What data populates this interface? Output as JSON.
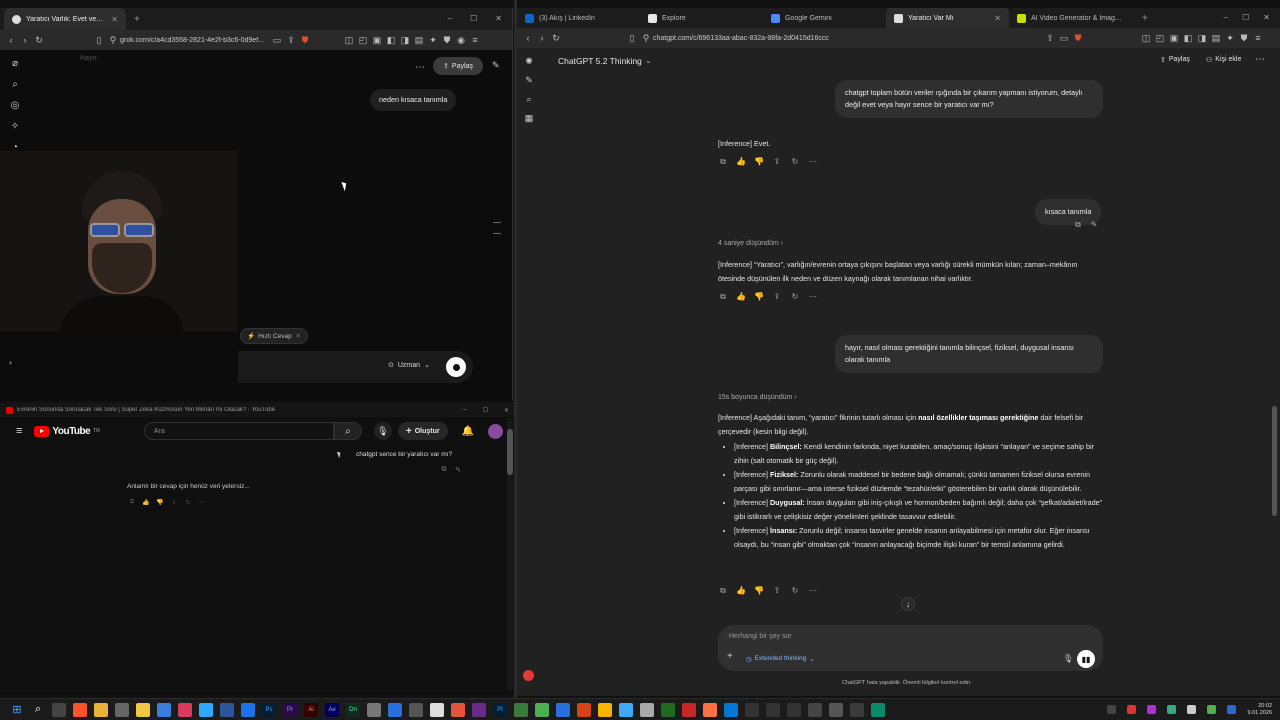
{
  "grok_window": {
    "tab_title": "Yaratıcı Varlık: Evet veya Hayır? ...",
    "url": "grok.com/c/a4cd3558-2821-4e2f-b3c6-0d9ef...",
    "faded_header": "Hayır.",
    "share_label": "Paylaş",
    "user_message": "neden kısaca tanımla",
    "quick_answer_chip": "Hızlı Cevap",
    "mode_label": "Uzman"
  },
  "youtube_window": {
    "title": "Evrenin Sonunda Sorulacak Tek Soru | Süper Zeka Kozmosun Yeri Mimarı mı Olacak? - YouTube",
    "logo_text": "YouTube",
    "logo_sup": "TR",
    "search_placeholder": "Ara",
    "create_label": "Oluştur",
    "chat_prompt": "chatgpt sence bir yaratıcı var mı?",
    "chat_response": "Anlamlı bir cevap için henüz veri yetersiz..."
  },
  "chatgpt_window": {
    "tabs": [
      {
        "label": "(3) Akış | LinkedIn",
        "color": "#0a66c2"
      },
      {
        "label": "Explore",
        "color": "#e8e8e8"
      },
      {
        "label": "Google Gemini",
        "color": "#4c8bf5"
      },
      {
        "label": "Yaratıcı Var Mı",
        "color": "#dddddd"
      },
      {
        "label": "AI Video Generator & Image Generat...",
        "color": "#c8e000"
      }
    ],
    "url": "chatgpt.com/c/696133aa-abac-832a-98fa-2d0415d16ccc",
    "model": "ChatGPT 5.2 Thinking",
    "share_label": "Paylaş",
    "add_people_label": "Kişi ekle",
    "msg1": "chatgpt toplam bütün veriler ışığında bir çıkarım yapmanı istiyorum, detaylı değil evet veya hayır sence bir yaratıcı var mı?",
    "reply1": "[Inference] Evet.",
    "msg2": "kısaca tanımla",
    "thought2": "4 saniye düşündüm",
    "reply2": "[Inference] “Yaratıcı”, varlığın/evrenin ortaya çıkışını başlatan veya varlığı sürekli mümkün kılan; zaman–mekânın ötesinde düşünülen ilk neden ve düzen kaynağı olarak tanımlanan nihai varlıktır.",
    "msg3": "hayır, nasıl olması gerektiğini tanımla bilinçsel, fiziksel, duygusal insansı olarak tanımla",
    "thought3": "15s boyunca düşündüm",
    "reply3_intro_a": "[Inference] Aşağıdaki tanım, “yaratıcı” fikrinin tutarlı olması için ",
    "reply3_intro_b": "nasıl özellikler taşıması gerektiğine",
    "reply3_intro_c": " dair felsefi bir çerçevedir (kesin bilgi değil).",
    "bullets": [
      {
        "tag": "[Inference]",
        "head": "Bilinçsel:",
        "text": " Kendi kendinin farkında, niyet kurabilen, amaç/sonuç ilişkisini “anlayan” ve seçime sahip bir zihin (salt otomatik bir güç değil)."
      },
      {
        "tag": "[Inference]",
        "head": "Fiziksel:",
        "text": " Zorunlu olarak maddesel bir bedene bağlı olmamalı; çünkü tamamen fiziksel olursa evrenin parçası gibi sınırlanır—ama isterse fiziksel düzlemde “tezahür/etki” gösterebilen bir varlık olarak düşünülebilir."
      },
      {
        "tag": "[Inference]",
        "head": "Duygusal:",
        "text": " İnsan duyguları gibi iniş-çıkışlı ve hormon/beden bağımlı değil; daha çok “şefkat/adalet/irade” gibi istikrarlı ve çelişkisiz değer yönelimleri şeklinde tasavvur edilebilir."
      },
      {
        "tag": "[Inference]",
        "head": "İnsansı:",
        "text": " Zorunlu değil; insansı tasvirler genelde insanın anlayabilmesi için metafor olur. Eğer insansı olsaydı, bu “insan gibi” olmaktan çok “insanın anlayacağı biçimde ilişki kuran” bir temsil anlamına gelirdi."
      }
    ],
    "input_placeholder": "Herhangi bir şey sor",
    "thinking_mode": "Extended thinking",
    "footer_note": "ChatGPT hata yapabilir. Önemli bilgileri kontrol edin."
  },
  "clock": {
    "time": "20:02",
    "date": "9.01.2026"
  }
}
